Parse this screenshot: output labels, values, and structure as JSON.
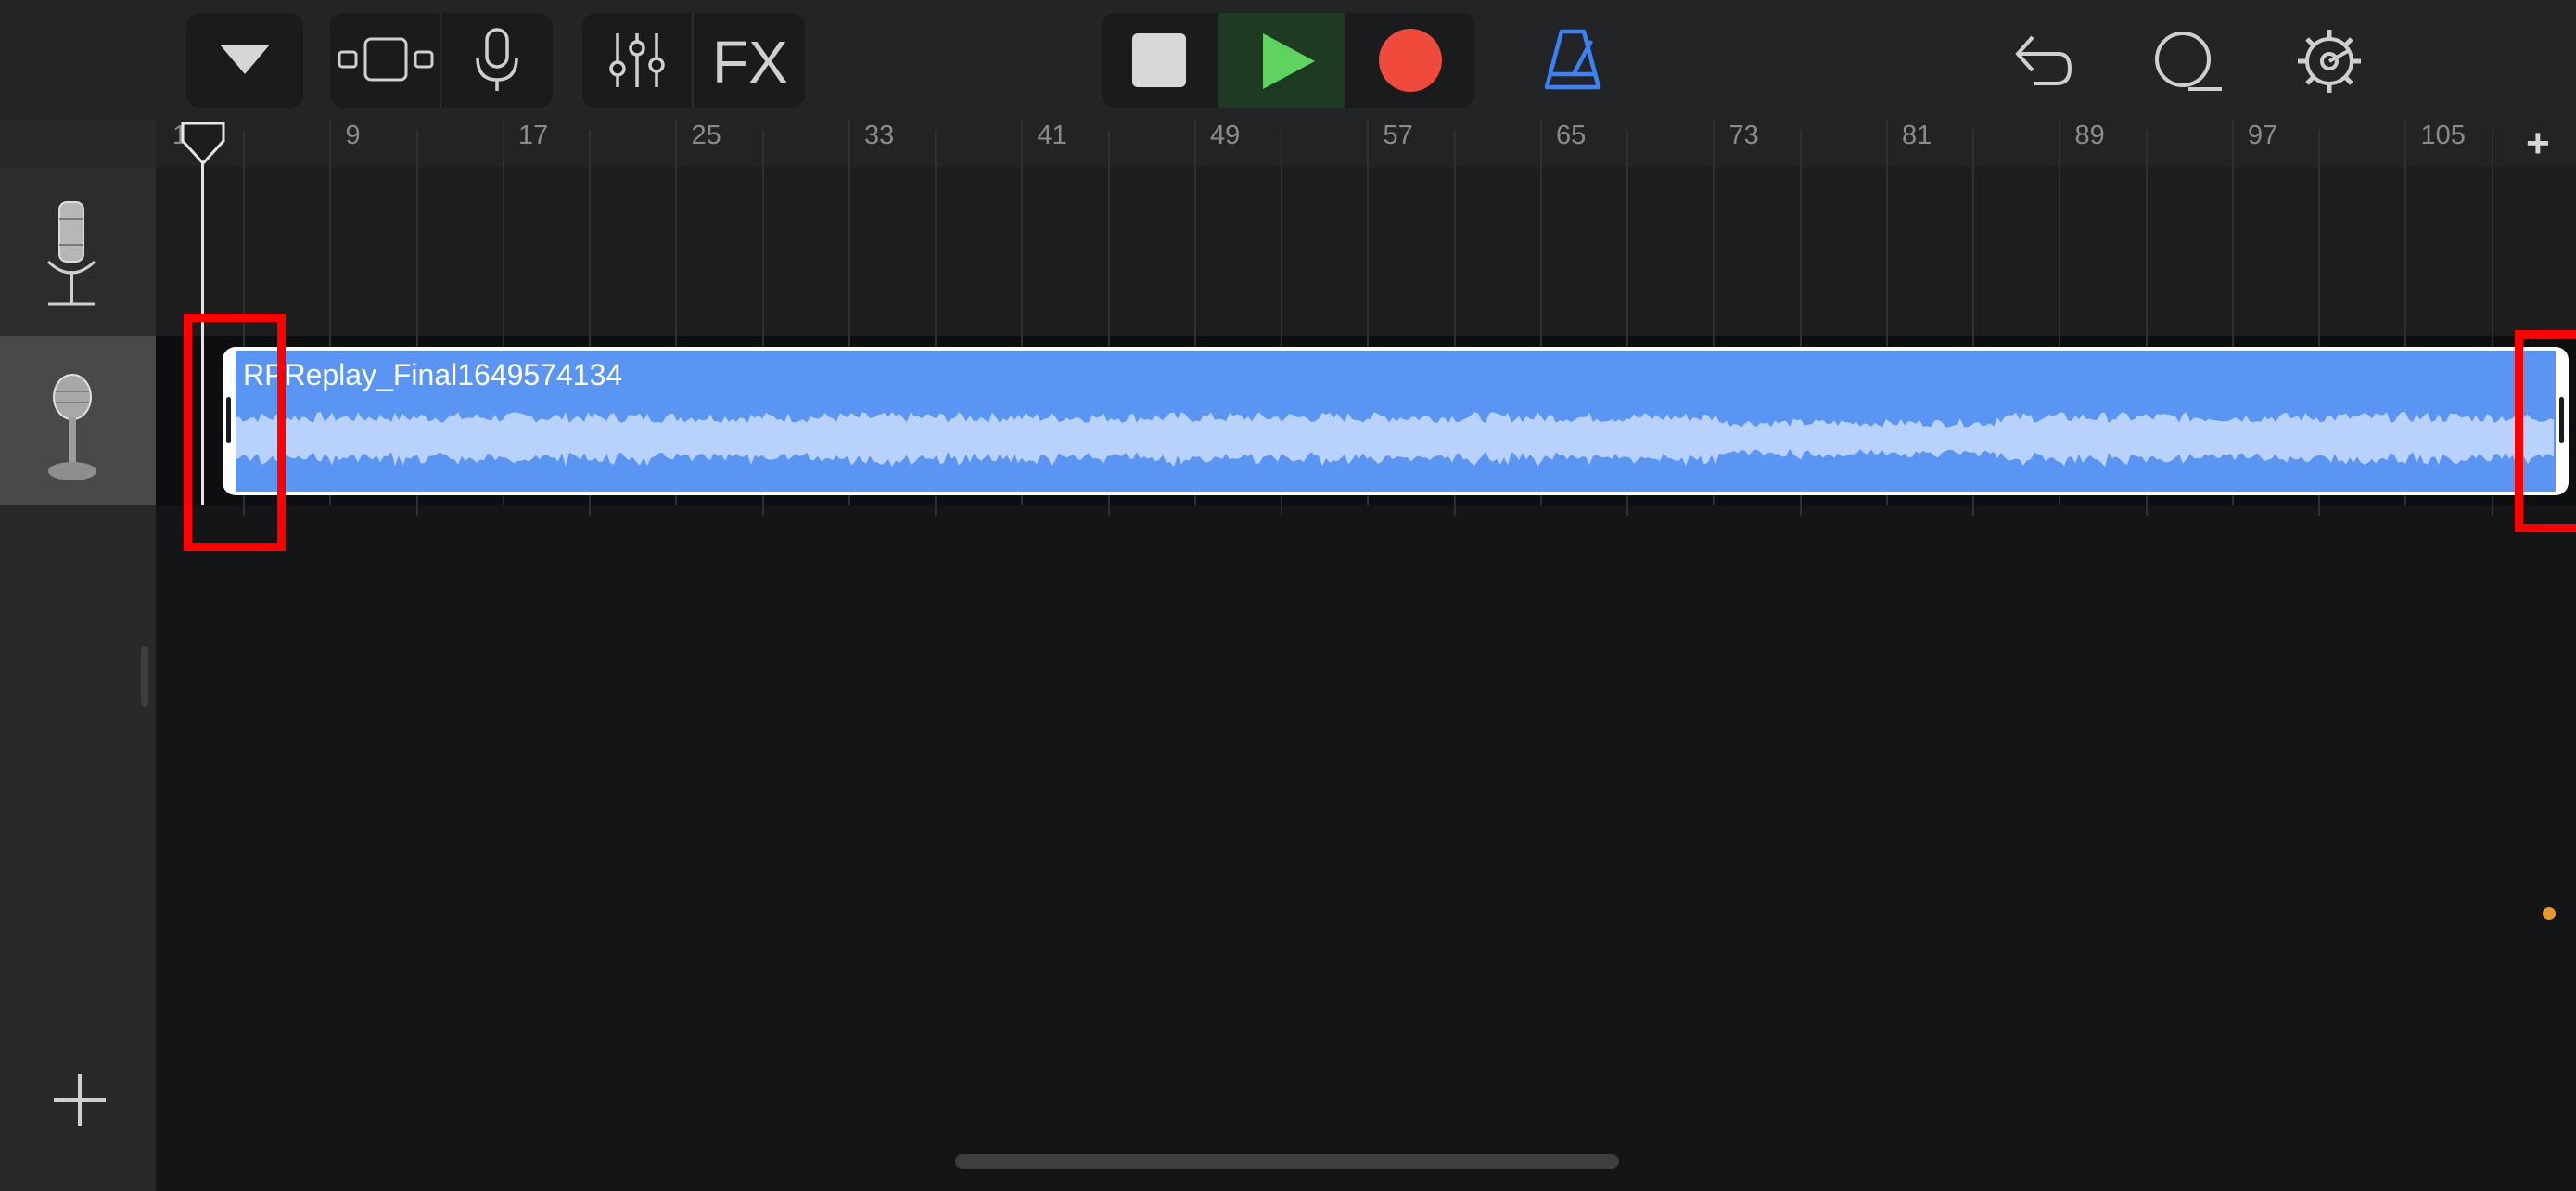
{
  "toolbar": {
    "browser_toggle_icon": "triangle-down-icon",
    "track_view_icon": "track-view-icon",
    "instrument_icon": "microphone-icon",
    "mixer_icon": "sliders-icon",
    "fx_label": "FX",
    "stop_icon": "stop-icon",
    "play_icon": "play-icon",
    "record_icon": "record-icon",
    "metronome_icon": "metronome-icon",
    "undo_icon": "undo-icon",
    "loop_icon": "loop-icon",
    "settings_icon": "gear-icon",
    "colors": {
      "play_bg": "#1f3a23",
      "play": "#5fd35f",
      "record": "#f04a3c",
      "metronome": "#3d82f4",
      "stop": "#d8d8d8"
    }
  },
  "ruler": {
    "bars": [
      "1",
      "9",
      "17",
      "25",
      "33",
      "41",
      "49",
      "57",
      "65",
      "73",
      "81",
      "89",
      "97",
      "105"
    ],
    "add_section_label": "+"
  },
  "tracks": [
    {
      "icon": "condenser-microphone-icon",
      "selected": false
    },
    {
      "icon": "vocal-microphone-icon",
      "selected": true
    }
  ],
  "region": {
    "name": "RPReplay_Final1649574134",
    "color": "#5a95f3",
    "waveform_color": "#b8d2fb"
  },
  "add_track_label": "+"
}
